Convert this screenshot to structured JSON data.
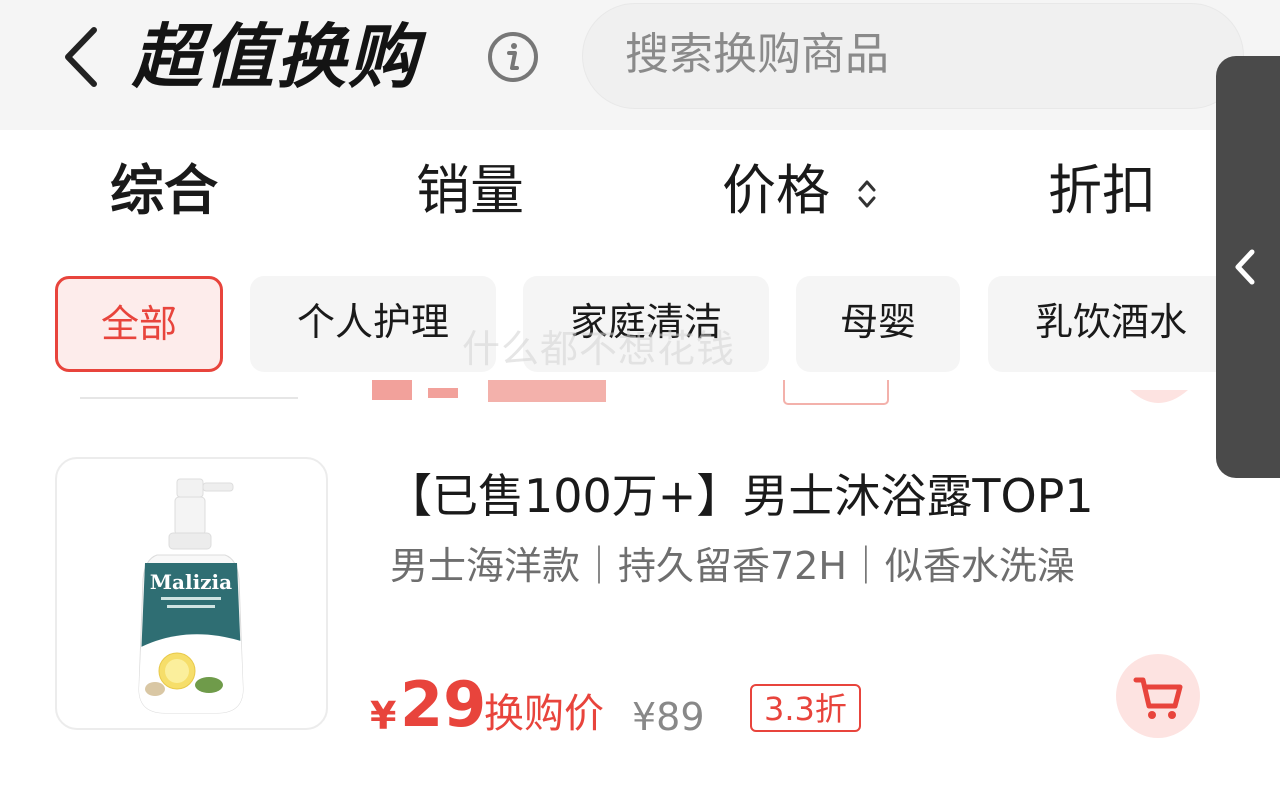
{
  "header": {
    "title": "超值换购",
    "search_placeholder": "搜索换购商品",
    "icons": {
      "back": "chevron-left-icon",
      "info": "info-icon"
    }
  },
  "sort_tabs": [
    {
      "label": "综合",
      "active": true
    },
    {
      "label": "销量",
      "active": false
    },
    {
      "label": "价格",
      "active": false,
      "icon": "sort-arrows-icon"
    },
    {
      "label": "折扣",
      "active": false
    }
  ],
  "categories": [
    {
      "label": "全部",
      "active": true
    },
    {
      "label": "个人护理",
      "active": false
    },
    {
      "label": "家庭清洁",
      "active": false
    },
    {
      "label": "母婴",
      "active": false
    },
    {
      "label": "乳饮酒水",
      "active": false
    }
  ],
  "watermark": "什么都不想花钱",
  "product": {
    "title": "【已售100万+】男士沐浴露TOP1",
    "subtitle": "男士海洋款｜持久留香72H｜似香水洗澡",
    "brand_on_image": "Malizia",
    "currency": "¥",
    "price": "29",
    "price_label": "换购价",
    "original_price": "¥89",
    "discount": "3.3折",
    "cart_icon": "cart-icon"
  },
  "side_tab_icon": "chevron-left-icon",
  "colors": {
    "accent": "#e8443c",
    "header_bg": "#f5f5f5",
    "side_tab": "#4a4a4a"
  }
}
